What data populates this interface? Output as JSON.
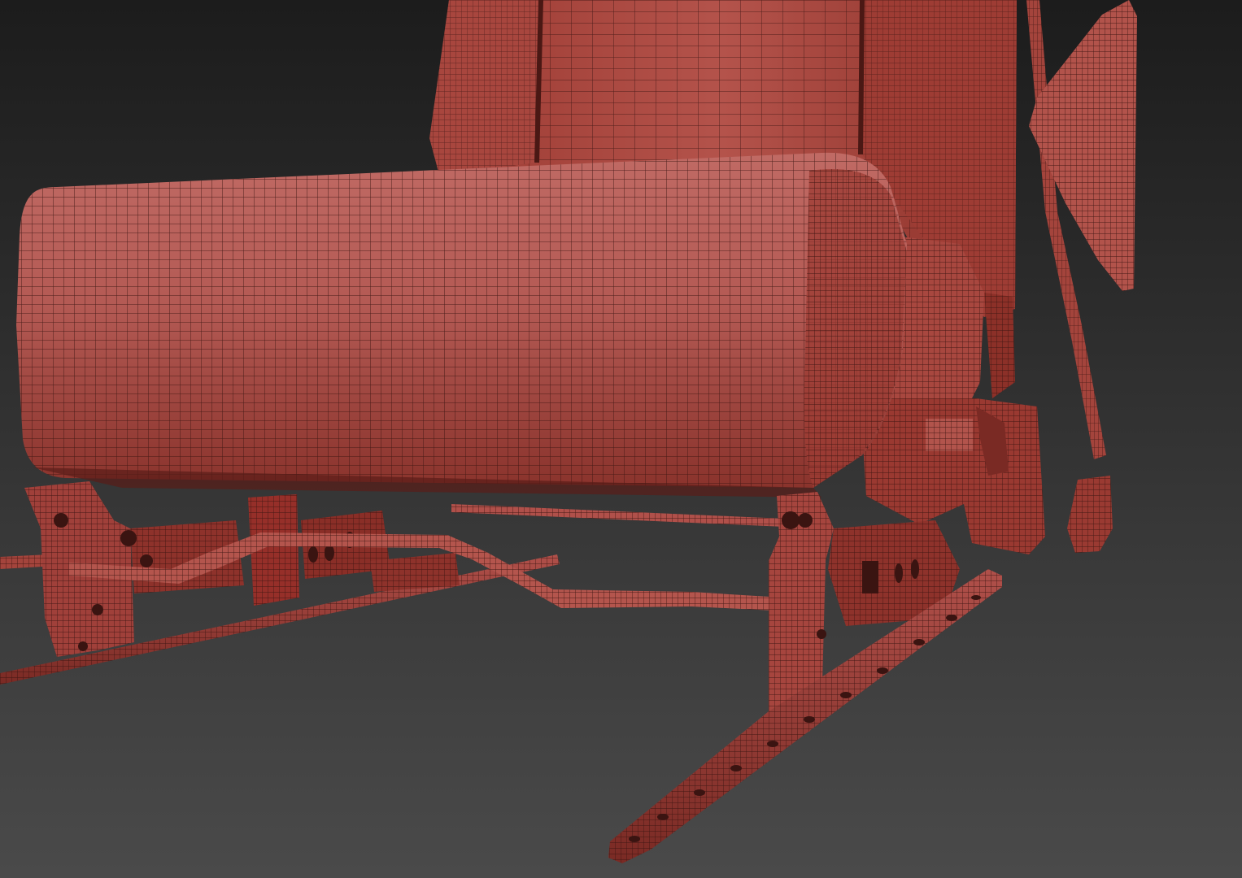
{
  "scene": {
    "subject": "seat-wireframe-render",
    "background": {
      "top": "#1c1c1c",
      "bottom": "#4a4a4a"
    },
    "mesh": {
      "fill_light": "#b9625e",
      "fill_mid": "#a4443c",
      "fill_dark": "#6e2420",
      "wire": "#3a1411"
    },
    "visible_text": []
  }
}
